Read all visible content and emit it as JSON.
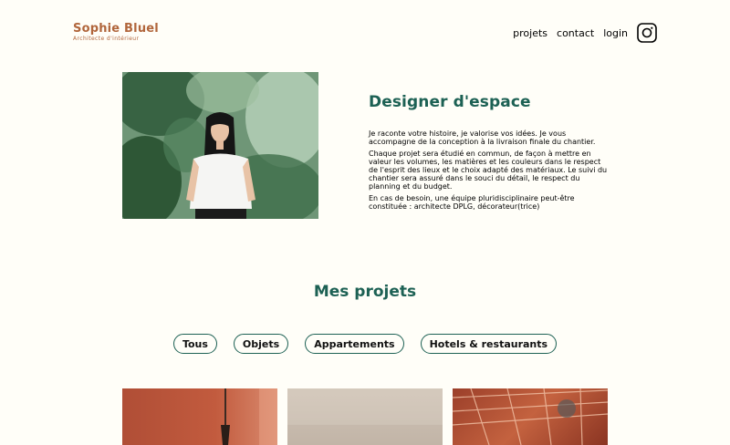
{
  "brand": {
    "name": "Sophie Bluel",
    "subtitle": "Architecte d'intérieur"
  },
  "nav": {
    "items": [
      "projets",
      "contact",
      "login"
    ],
    "social_icon": "instagram-icon"
  },
  "intro": {
    "title": "Designer d'espace",
    "paragraphs": [
      "Je raconte votre histoire, je valorise vos idées. Je vous accompagne de la conception à la livraison finale du chantier.",
      "Chaque projet sera étudié en commun, de façon à mettre en valeur les volumes, les matières et les couleurs dans le respect de l'esprit des lieux et le choix adapté des matériaux. Le suivi du chantier sera assuré dans le souci du détail, le respect du planning et du budget.",
      "En cas de besoin, une équipe pluridisciplinaire peut-être constituée : architecte DPLG, décorateur(trice)"
    ]
  },
  "projects": {
    "title": "Mes projets",
    "filters": [
      "Tous",
      "Objets",
      "Appartements",
      "Hotels & restaurants"
    ]
  },
  "colors": {
    "brand": "#b1663c",
    "accent": "#1d6154",
    "background": "#fffef8"
  }
}
